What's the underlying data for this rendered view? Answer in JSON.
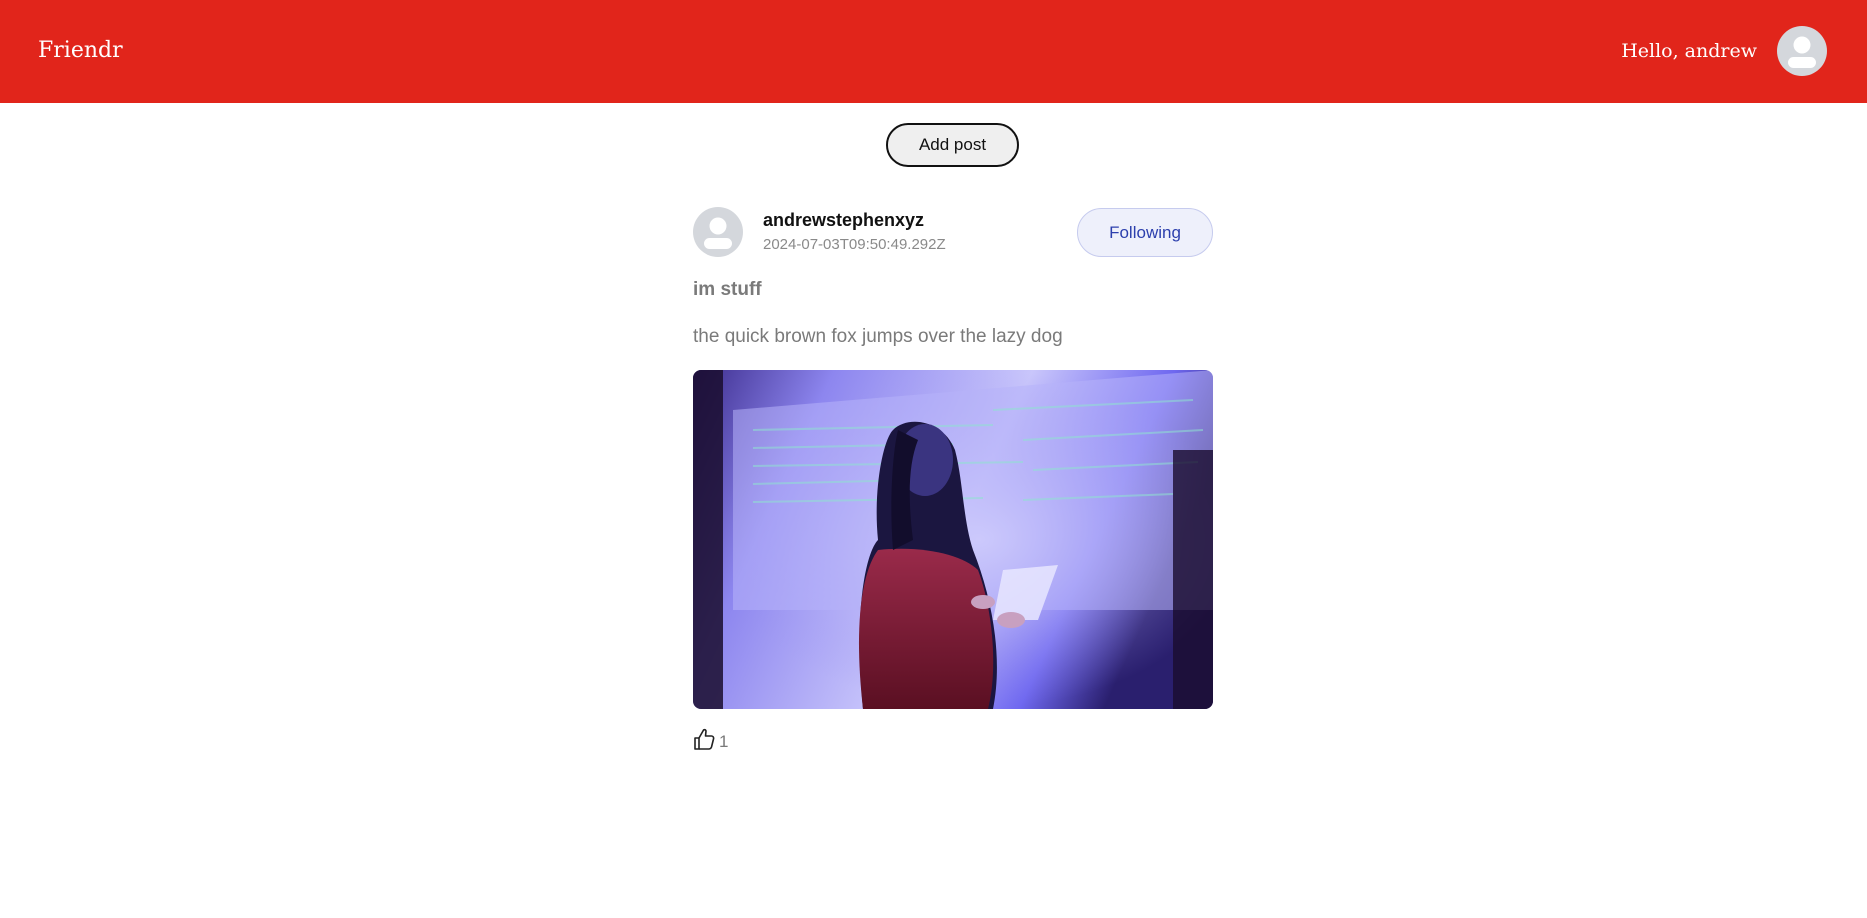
{
  "navbar": {
    "brand": "Friendr",
    "greeting": "Hello, andrew",
    "background_color": "#e1251b",
    "avatar_icon": "user-avatar-icon"
  },
  "actions": {
    "add_post_label": "Add post"
  },
  "post": {
    "author": "andrewstephenxyz",
    "timestamp": "2024-07-03T09:50:49.292Z",
    "follow_label": "Following",
    "title": "im stuff",
    "body": "the quick brown fox jumps over the lazy dog",
    "like_icon": "thumbs-up-icon",
    "like_count": "1",
    "author_avatar_icon": "user-avatar-icon"
  }
}
